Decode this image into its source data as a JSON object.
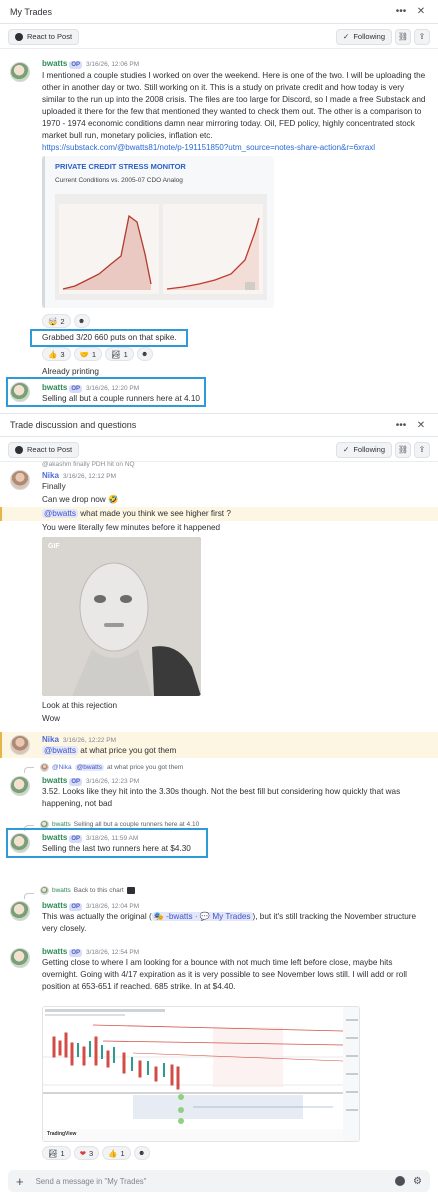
{
  "panel1": {
    "title": "My Trades",
    "react_btn": "React to Post",
    "following": "Following",
    "messages": [
      {
        "author": "bwatts",
        "badge": "OP",
        "time": "3/16/26, 12:06 PM",
        "text": "I mentioned a couple studies I worked on over the weekend. Here is one of the two. I will be uploading the other in another day or two. Still working on it. This is a study on private credit and how today is very similar to the run up into the 2008 crisis. The files are too large for Discord, so I made a free Substack and uploaded it there for the few that mentioned they wanted to check them out. The other is a comparison to 1970 - 1974 economic conditions damn near mirroring today. Oil, FED policy, highly concentrated stock market bull run, monetary policies, inflation etc.",
        "link": "https://substack.com/@bwatts81/note/p-191151850?utm_source=notes-share-action&r=6xraxl",
        "embed_title": "PRIVATE CREDIT STRESS MONITOR",
        "embed_subtitle": "Current Conditions vs. 2005-07 CDO Analog",
        "reaction_count": "2"
      },
      {
        "text": "Grabbed 3/20 660 puts on that spike.",
        "reactions": [
          "3",
          "1",
          "1"
        ]
      },
      {
        "text": "Already printing"
      },
      {
        "author": "bwatts",
        "badge": "OP",
        "time": "3/16/26, 12:20 PM",
        "text": "Selling all but a couple runners here at 4.10"
      }
    ]
  },
  "panel2": {
    "title": "Trade discussion and questions",
    "react_btn": "React to Post",
    "following": "Following",
    "top_reply": "@akashm  finally PDH hit on NQ",
    "nika1": {
      "author": "Nika",
      "time": "3/16/26, 12:12 PM",
      "lines": [
        "Finally",
        "Can we drop now 🤣"
      ],
      "mention_line_mention": "@bwatts",
      "mention_line_text": " what made you think we see higher first ?",
      "line_after": "You were literally few minutes before it happened",
      "gif_label": "GIF",
      "after_gif": [
        "Look at this rejection",
        "Wow"
      ]
    },
    "nika2": {
      "author": "Nika",
      "time": "3/16/26, 12:22 PM",
      "mention": "@bwatts",
      "text": " at what price you got them"
    },
    "bw1": {
      "reply_author": "@Nika",
      "reply_mention": "@bwatts",
      "reply_text": "at what price you got them",
      "author": "bwatts",
      "badge": "OP",
      "time": "3/16/26, 12:23 PM",
      "text": "3.52. Looks like they hit into the 3.30s though. Not the best fill but considering how quickly that was happening, not bad"
    },
    "bw2": {
      "reply_author": "bwatts",
      "reply_text": "Selling all but a couple runners here at 4.10",
      "author": "bwatts",
      "badge": "OP",
      "time": "3/18/26, 11:59 AM",
      "text": "Selling the last two runners here at $4.30"
    },
    "bw3": {
      "reply_author": "bwatts",
      "reply_text": "Back to this chart",
      "author": "bwatts",
      "badge": "OP",
      "time": "3/18/26, 12:04 PM",
      "text_before": "This was actually the original (",
      "chip": "-bwatts · ",
      "chip_channel": "My Trades",
      "text_after": "), but it's still tracking the November structure very closely."
    },
    "bw4": {
      "author": "bwatts",
      "badge": "OP",
      "time": "3/18/26, 12:54 PM",
      "text": "Getting close to where I am looking for a bounce with not much time left before close, maybe hits overnight. Going with 4/17 expiration as it is very possible to see November lows still. I will add or roll position at 653-651 if reached. 685 strike. In at $4.40.",
      "chart_brand": "TradingView",
      "reactions": [
        "1",
        "3",
        "1"
      ]
    },
    "composer_placeholder": "Send a message in \"My Trades\""
  }
}
